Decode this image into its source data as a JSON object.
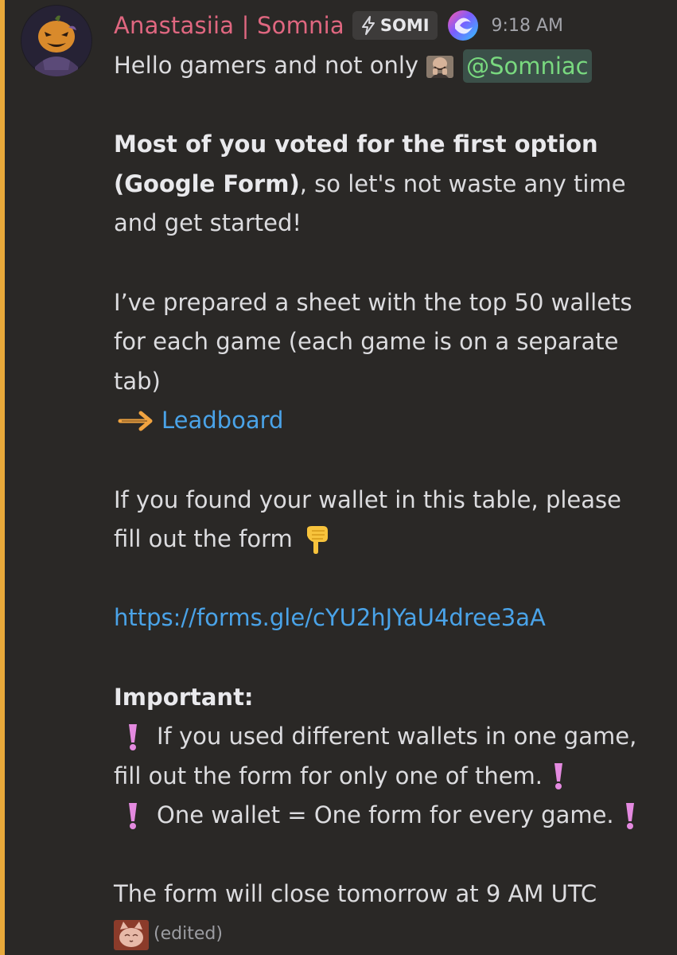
{
  "message": {
    "username": "Anastasiia | Somnia",
    "tag_label": "SOMI",
    "timestamp": "9:18 AM",
    "edited_label": "(edited)",
    "greeting": "Hello gamers and not only",
    "mention": "@Somniac",
    "p1_bold_line1": "Most of you voted for the first option",
    "p1_bold_line2": "(Google Form)",
    "p1_rest_line2": ", so let's not waste any time",
    "p1_line3": "and get started!",
    "p2_line1": "I’ve prepared a sheet with the top 50 wallets",
    "p2_line2": "for each game (each game is on a separate",
    "p2_line3": "tab)",
    "leaderboard_link": "Leadboard",
    "p3_line1": "If you found your wallet in this table, please",
    "p3_line2": "fill out the form",
    "form_url": "https://forms.gle/cYU2hJYaU4dree3aA",
    "important_heading": "Important:",
    "imp_line1": "If you used different wallets in one game,",
    "imp_line2": "fill out the form for only one of them.",
    "imp_line3": "One wallet = One form for every game.",
    "closing": "The form will close tomorrow at 9 AM UTC"
  },
  "icons": {
    "tag_icon": "lightning-icon",
    "role_icon": "swirl-gradient-icon",
    "greeting_emoji": "laughing-man-emoji",
    "arrow_emoji": "right-arrow-emoji",
    "pointing_emoji": "pointing-down-emoji",
    "exclamation_emoji": "pink-exclamation-emoji",
    "sticker_emoji": "cat-face-emoji"
  },
  "colors": {
    "background": "#2a2826",
    "username": "#e06780",
    "link": "#4aa3e8",
    "mention_text": "#79d97f",
    "mention_bar": "#e8a93a",
    "exclamation": "#e48ae0"
  }
}
